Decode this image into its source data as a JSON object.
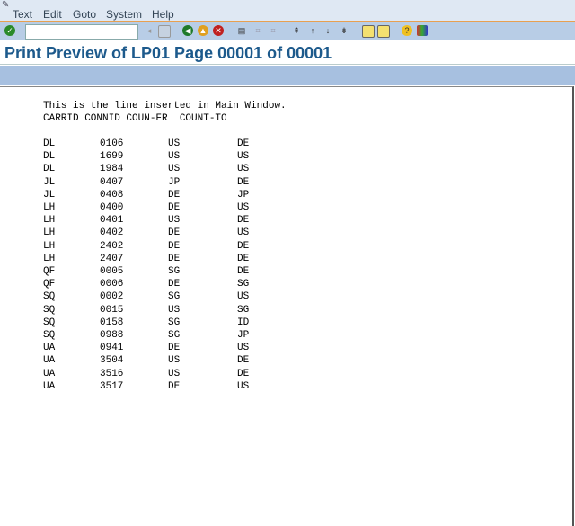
{
  "menu": [
    "Text",
    "Edit",
    "Goto",
    "System",
    "Help"
  ],
  "title": "Print Preview of LP01 Page 00001 of 00001",
  "command_field": "",
  "content": {
    "intro": "This is the line inserted in Main Window.",
    "header": "CARRID CONNID COUN-FR  COUNT-TO",
    "rows": [
      [
        "DL",
        "0106",
        "US",
        "DE"
      ],
      [
        "DL",
        "1699",
        "US",
        "US"
      ],
      [
        "DL",
        "1984",
        "US",
        "US"
      ],
      [
        "JL",
        "0407",
        "JP",
        "DE"
      ],
      [
        "JL",
        "0408",
        "DE",
        "JP"
      ],
      [
        "LH",
        "0400",
        "DE",
        "US"
      ],
      [
        "LH",
        "0401",
        "US",
        "DE"
      ],
      [
        "LH",
        "0402",
        "DE",
        "US"
      ],
      [
        "LH",
        "2402",
        "DE",
        "DE"
      ],
      [
        "LH",
        "2407",
        "DE",
        "DE"
      ],
      [
        "QF",
        "0005",
        "SG",
        "DE"
      ],
      [
        "QF",
        "0006",
        "DE",
        "SG"
      ],
      [
        "SQ",
        "0002",
        "SG",
        "US"
      ],
      [
        "SQ",
        "0015",
        "US",
        "SG"
      ],
      [
        "SQ",
        "0158",
        "SG",
        "ID"
      ],
      [
        "SQ",
        "0988",
        "SG",
        "JP"
      ],
      [
        "UA",
        "0941",
        "DE",
        "US"
      ],
      [
        "UA",
        "3504",
        "US",
        "DE"
      ],
      [
        "UA",
        "3516",
        "US",
        "DE"
      ],
      [
        "UA",
        "3517",
        "DE",
        "US"
      ]
    ]
  },
  "colors": {
    "title": "#1d5a8c",
    "toolbar": "#b8cde6",
    "band": "#a7c0e0"
  }
}
